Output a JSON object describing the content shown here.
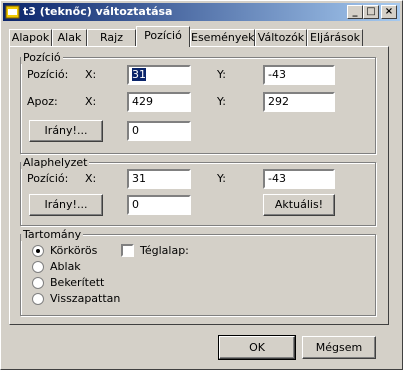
{
  "window": {
    "title": "t3 (teknőc) változtatása"
  },
  "tabs": [
    "Alapok",
    "Alak",
    "Rajz",
    "Pozíció",
    "Események",
    "Változók",
    "Eljárások"
  ],
  "active_tab": "Pozíció",
  "pozicio_group": {
    "title": "Pozíció",
    "row1": {
      "label": "Pozíció:",
      "x_label": "X:",
      "x_value": "31",
      "y_label": "Y:",
      "y_value": "-43"
    },
    "row2": {
      "label": "Apoz:",
      "x_label": "X:",
      "x_value": "429",
      "y_label": "Y:",
      "y_value": "292"
    },
    "irany_button": "Irány!...",
    "irany_value": "0"
  },
  "alaphelyzet_group": {
    "title": "Alaphelyzet",
    "row1": {
      "label": "Pozíció:",
      "x_label": "X:",
      "x_value": "31",
      "y_label": "Y:",
      "y_value": "-43"
    },
    "irany_button": "Irány!...",
    "irany_value": "0",
    "aktualis_button": "Aktuális!"
  },
  "tartomany_group": {
    "title": "Tartomány",
    "options": [
      "Körkörös",
      "Ablak",
      "Bekerített",
      "Visszapattan"
    ],
    "selected": "Körkörös",
    "teglalap_label": "Téglalap:",
    "teglalap_checked": false
  },
  "footer": {
    "ok": "OK",
    "cancel": "Mégsem"
  }
}
